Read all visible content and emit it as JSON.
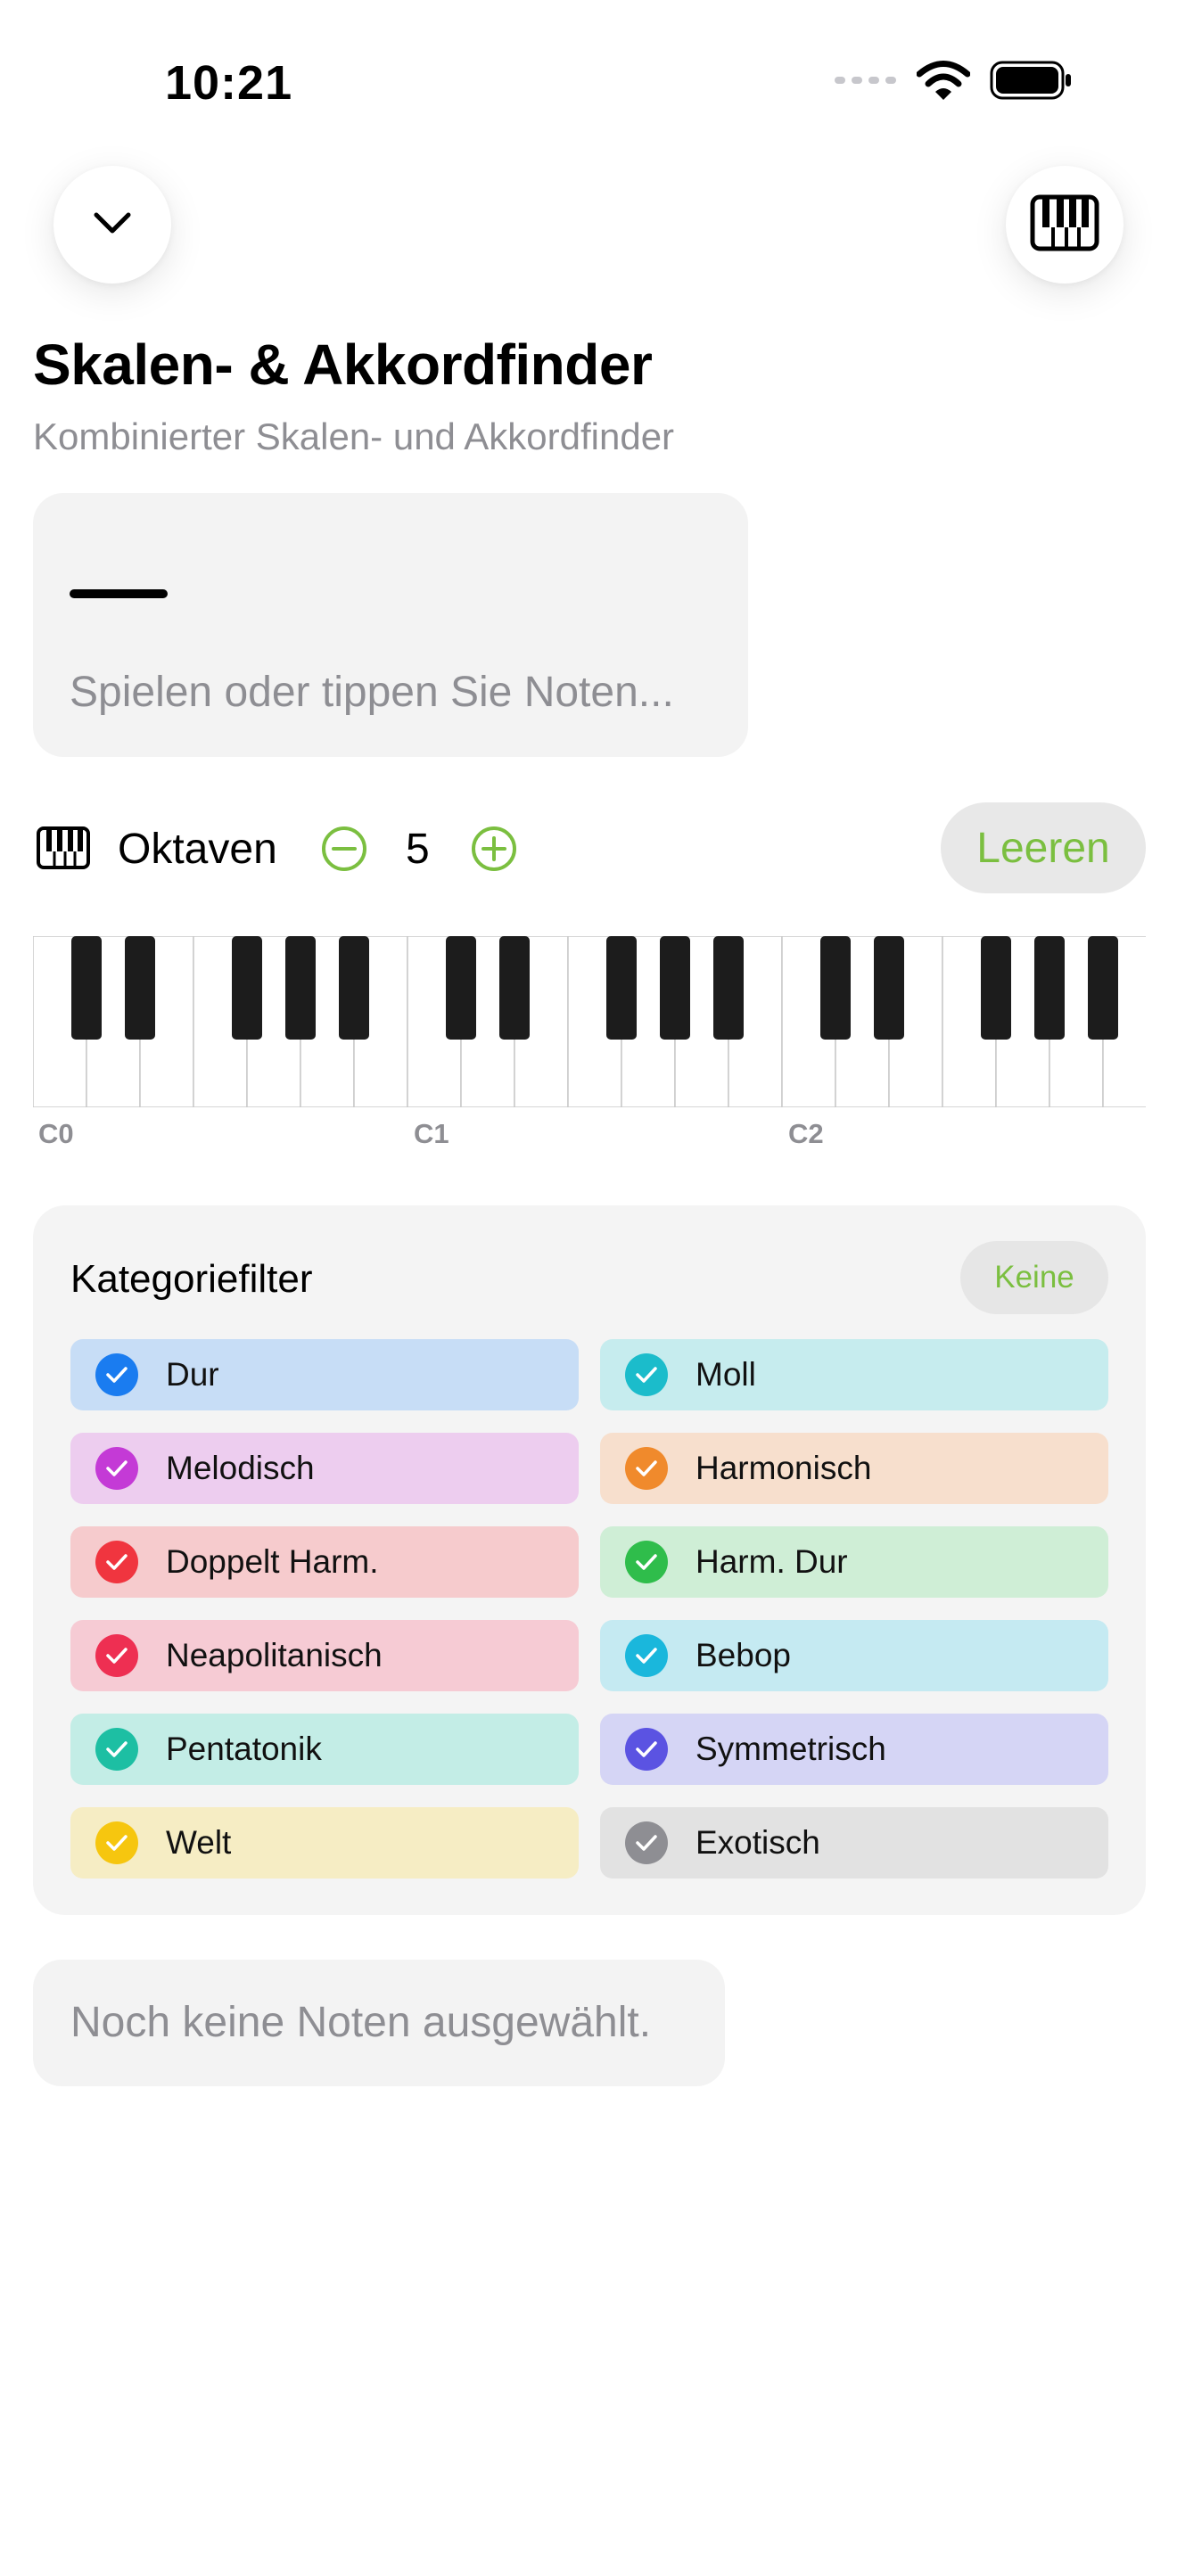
{
  "status_bar": {
    "time": "10:21"
  },
  "header": {
    "collapse_icon": "chevron-down-icon",
    "keyboard_icon": "piano-keys-icon",
    "title": "Skalen- & Akkordfinder",
    "subtitle": "Kombinierter Skalen- und Akkordfinder"
  },
  "input": {
    "placeholder": "Spielen oder tippen Sie Noten..."
  },
  "octaves": {
    "label": "Oktaven",
    "value": "5",
    "clear_label": "Leeren"
  },
  "keyboard": {
    "octave_labels": [
      "C0",
      "C1",
      "C2"
    ]
  },
  "filter": {
    "title": "Kategoriefilter",
    "none_label": "Keine",
    "categories": [
      {
        "label": "Dur",
        "bg": "#c7ddf6",
        "check": "#1a7cf0"
      },
      {
        "label": "Moll",
        "bg": "#c6ecee",
        "check": "#1bbccb"
      },
      {
        "label": "Melodisch",
        "bg": "#edcdef",
        "check": "#c43ad6"
      },
      {
        "label": "Harmonisch",
        "bg": "#f7dfcd",
        "check": "#f08a2c"
      },
      {
        "label": "Doppelt Harm.",
        "bg": "#f6cbcd",
        "check": "#f0353f"
      },
      {
        "label": "Harm. Dur",
        "bg": "#cfeed6",
        "check": "#2fbd4b"
      },
      {
        "label": "Neapolitanisch",
        "bg": "#f6cbd4",
        "check": "#ee2f52"
      },
      {
        "label": "Bebop",
        "bg": "#c5eaf2",
        "check": "#1ab7dc"
      },
      {
        "label": "Pentatonik",
        "bg": "#c3ede6",
        "check": "#1dbfa3"
      },
      {
        "label": "Symmetrisch",
        "bg": "#d5d5f5",
        "check": "#5b53e2"
      },
      {
        "label": "Welt",
        "bg": "#f6edc4",
        "check": "#f6c60f"
      },
      {
        "label": "Exotisch",
        "bg": "#e2e2e2",
        "check": "#8e8e93"
      }
    ]
  },
  "empty_state": {
    "text": "Noch keine Noten ausgewählt."
  }
}
